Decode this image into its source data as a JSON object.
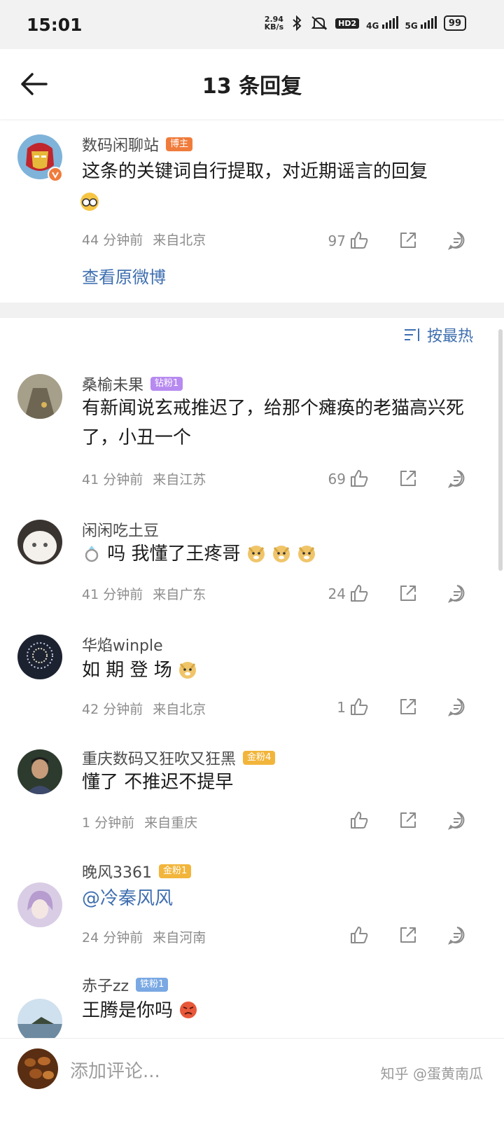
{
  "status_bar": {
    "time": "15:01",
    "net_speed_value": "2.94",
    "net_speed_unit": "KB/s",
    "hd_label": "HD2",
    "network_a": "4G",
    "network_b": "5G",
    "battery": "99"
  },
  "header": {
    "title": "13 条回复"
  },
  "post": {
    "author": "数码闲聊站",
    "author_badge": "博主",
    "text": "这条的关键词自行提取，对近期谣言的回复",
    "time": "44 分钟前",
    "location": "来自北京",
    "likes": "97",
    "view_original": "查看原微博"
  },
  "sort": {
    "label": "按最热"
  },
  "comments": [
    {
      "name": "桑榆未果",
      "badge": "钻粉1",
      "text": "有新闻说玄戒推迟了，给那个瘫痪的老猫高兴死了，小丑一个",
      "time": "41 分钟前",
      "location": "来自江苏",
      "likes": "69"
    },
    {
      "name": "闲闲吃土豆",
      "badge": "",
      "text": "吗 我懂了王疼哥",
      "time": "41 分钟前",
      "location": "来自广东",
      "likes": "24"
    },
    {
      "name": "华焰winple",
      "badge": "",
      "text": "如 期 登 场",
      "time": "42 分钟前",
      "location": "来自北京",
      "likes": "1"
    },
    {
      "name": "重庆数码又狂吹又狂黑",
      "badge": "金粉4",
      "text": "懂了 不推迟不提早",
      "time": "1 分钟前",
      "location": "来自重庆",
      "likes": ""
    },
    {
      "name": "晚风3361",
      "badge": "金粉1",
      "text": "@冷秦风风",
      "time": "24 分钟前",
      "location": "来自河南",
      "likes": ""
    },
    {
      "name": "赤子zz",
      "badge": "铁粉1",
      "text": "王腾是你吗",
      "time": "",
      "location": "",
      "likes": ""
    }
  ],
  "input": {
    "placeholder": "添加评论..."
  },
  "watermark": "知乎 @蛋黄南瓜",
  "colors": {
    "link": "#3f6fb0",
    "owner_badge": "#f07c3c",
    "diamond_badge": "#b78af0",
    "gold_badge": "#f2b53b",
    "iron_badge": "#79a8e3"
  },
  "icons": [
    "back-arrow-icon",
    "bluetooth-icon",
    "mute-icon",
    "like-icon",
    "share-icon",
    "comment-icon",
    "sort-icon"
  ]
}
